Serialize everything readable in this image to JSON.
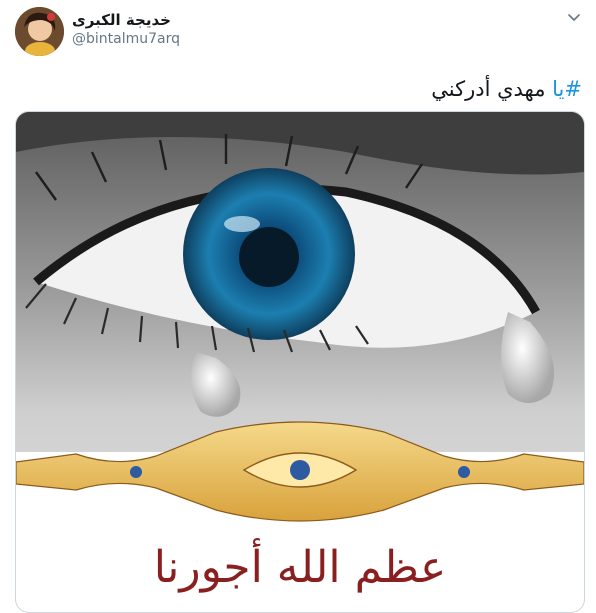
{
  "tweet": {
    "display_name": "خديجة الكبرى",
    "handle": "@bintalmu7arq",
    "hashtag": "#يا",
    "text_rest": " مهدي أدركني"
  },
  "media": {
    "calligraphy_text": "عظم الله أجورنا"
  },
  "icons": {
    "avatar": "user-avatar-icon",
    "menu": "chevron-down-icon"
  },
  "colors": {
    "hashtag": "#1b95e0",
    "handle": "#657786",
    "text": "#14171a",
    "border": "#ccd6dd",
    "iris": "#1c7fb0"
  }
}
